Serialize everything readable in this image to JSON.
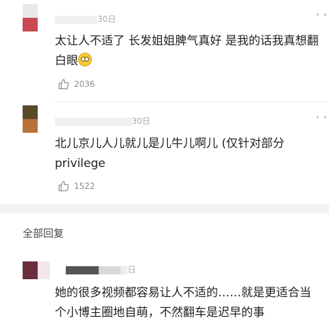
{
  "comments": [
    {
      "avatar_colors": [
        "#e9e9e9",
        "#c84a52"
      ],
      "time": "30日",
      "text_lines": [
        "太让人不适了 长发姐姐脾气真好 是我的话我真想翻",
        "白眼"
      ],
      "emoji": "rolling-eyes-emoji",
      "likes": "2036"
    },
    {
      "avatar_colors": [
        "#5a4a2a",
        "#b8733a"
      ],
      "time": "30日",
      "text_lines": [
        "北儿京儿人儿就儿是儿牛儿啊儿 (仅针对部分",
        "privilege"
      ],
      "likes": "1522"
    }
  ],
  "section_title": "全部回复",
  "reply": {
    "avatar_colors": [
      "#6a2e3c",
      "#f3e6ea"
    ],
    "time": "日",
    "text_lines": [
      "她的很多视频都容易让人不适的……就是更适合当",
      "个小博主圈地自萌，不然翻车是迟早的事"
    ]
  },
  "icons": {
    "like": "thumbs-up-icon",
    "more": "more-dots-icon"
  },
  "colors": {
    "text": "#222222",
    "meta": "#aaaaaa",
    "divider": "#f2f2f2"
  }
}
